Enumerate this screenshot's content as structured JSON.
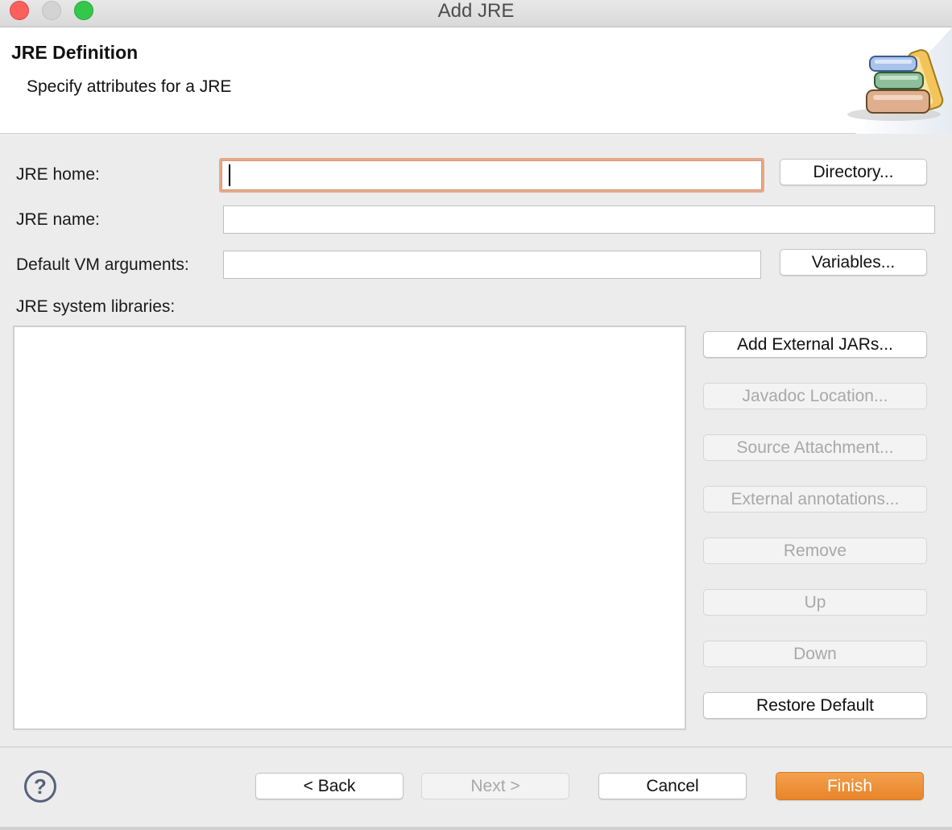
{
  "window": {
    "title": "Add JRE"
  },
  "banner": {
    "title": "JRE Definition",
    "subtitle": "Specify attributes for a JRE",
    "icon": "books-icon"
  },
  "form": {
    "jre_home_label": "JRE home:",
    "jre_home_value": "",
    "jre_name_label": "JRE name:",
    "jre_name_value": "",
    "vm_args_label": "Default VM arguments:",
    "vm_args_value": "",
    "libraries_label": "JRE system libraries:",
    "directory_button": "Directory...",
    "variables_button": "Variables..."
  },
  "library_buttons": [
    {
      "label": "Add External JARs...",
      "enabled": true
    },
    {
      "label": "Javadoc Location...",
      "enabled": false
    },
    {
      "label": "Source Attachment...",
      "enabled": false
    },
    {
      "label": "External annotations...",
      "enabled": false
    },
    {
      "label": "Remove",
      "enabled": false
    },
    {
      "label": "Up",
      "enabled": false
    },
    {
      "label": "Down",
      "enabled": false
    },
    {
      "label": "Restore Default",
      "enabled": true
    }
  ],
  "footer": {
    "help_icon": "?",
    "back_button": "< Back",
    "next_button": "Next >",
    "cancel_button": "Cancel",
    "finish_button": "Finish"
  },
  "colors": {
    "primary_button": "#e8852a",
    "focus_ring": "#e5a888"
  }
}
